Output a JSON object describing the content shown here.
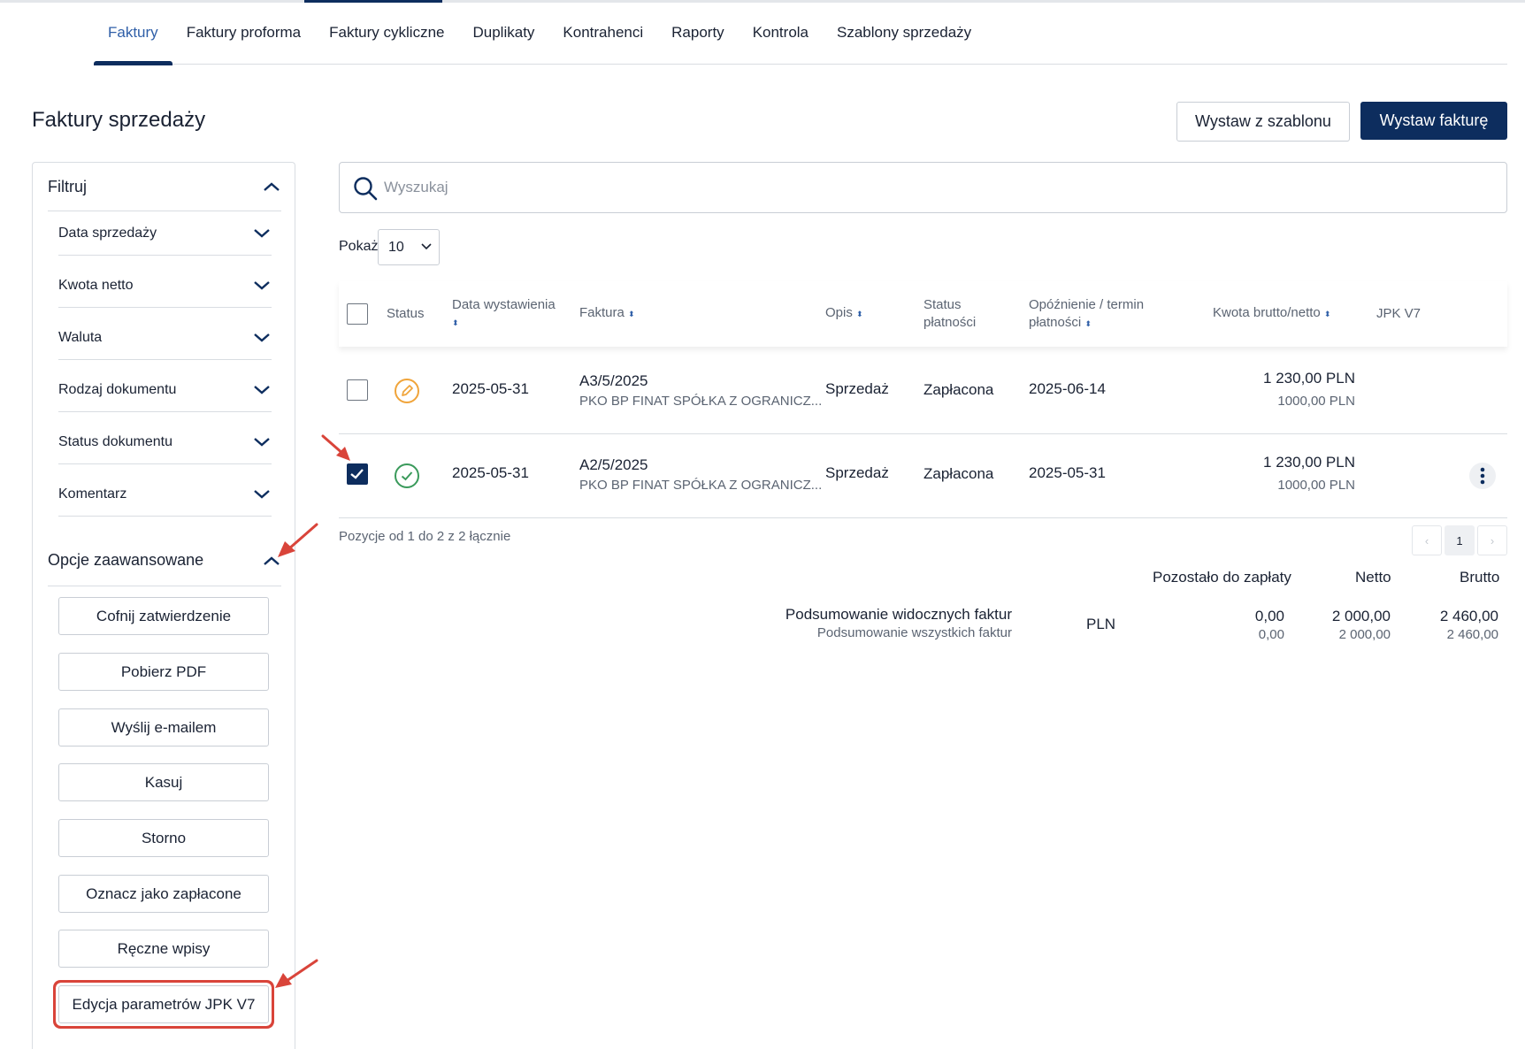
{
  "tabs": [
    {
      "label": "Faktury",
      "active": true
    },
    {
      "label": "Faktury proforma"
    },
    {
      "label": "Faktury cykliczne"
    },
    {
      "label": "Duplikaty"
    },
    {
      "label": "Kontrahenci"
    },
    {
      "label": "Raporty"
    },
    {
      "label": "Kontrola"
    },
    {
      "label": "Szablony sprzedaży"
    }
  ],
  "page_title": "Faktury sprzedaży",
  "actions": {
    "from_template": "Wystaw z szablonu",
    "issue_invoice": "Wystaw fakturę"
  },
  "sidebar": {
    "filter_title": "Filtruj",
    "filters": [
      "Data sprzedaży",
      "Kwota netto",
      "Waluta",
      "Rodzaj dokumentu",
      "Status dokumentu",
      "Komentarz"
    ],
    "advanced_title": "Opcje zaawansowane",
    "advanced_buttons": [
      "Cofnij zatwierdzenie",
      "Pobierz PDF",
      "Wyślij e-mailem",
      "Kasuj",
      "Storno",
      "Oznacz jako zapłacone",
      "Ręczne wpisy",
      "Edycja parametrów JPK V7"
    ]
  },
  "search": {
    "placeholder": "Wyszukaj"
  },
  "page_size": {
    "label": "Pokaż",
    "value": "10"
  },
  "table": {
    "headers": {
      "status": "Status",
      "issue_date": "Data wystawienia",
      "invoice": "Faktura",
      "description": "Opis",
      "payment_status": [
        "Status",
        "płatności"
      ],
      "delay": [
        "Opóźnienie / termin",
        "płatności"
      ],
      "amount": "Kwota brutto/netto",
      "jpk": "JPK V7"
    },
    "rows": [
      {
        "checked": false,
        "status_icon": "pencil-circle-icon",
        "issue_date": "2025-05-31",
        "number": "A3/5/2025",
        "client": "PKO BP FINAT SPÓŁKA Z OGRANICZ...",
        "description": "Sprzedaż",
        "payment_status": "Zapłacona",
        "due": "2025-06-14",
        "gross": "1 230,00 PLN",
        "net": "1000,00 PLN"
      },
      {
        "checked": true,
        "status_icon": "check-circle-icon",
        "issue_date": "2025-05-31",
        "number": "A2/5/2025",
        "client": "PKO BP FINAT SPÓŁKA Z OGRANICZ...",
        "description": "Sprzedaż",
        "payment_status": "Zapłacona",
        "due": "2025-05-31",
        "gross": "1 230,00 PLN",
        "net": "1000,00 PLN"
      }
    ]
  },
  "pagination": {
    "info": "Pozycje od 1 do 2 z 2 łącznie",
    "prev": "‹",
    "current": "1",
    "next": "›"
  },
  "summary": {
    "headers": {
      "remaining": "Pozostało do zapłaty",
      "net": "Netto",
      "gross": "Brutto"
    },
    "visible_label": "Podsumowanie widocznych faktur",
    "all_label": "Podsumowanie wszystkich faktur",
    "currency": "PLN",
    "visible": {
      "remaining": "0,00",
      "net": "2 000,00",
      "gross": "2 460,00"
    },
    "all": {
      "remaining": "0,00",
      "net": "2 000,00",
      "gross": "2 460,00"
    }
  },
  "colors": {
    "primary": "#0d2d5e",
    "link": "#2f5fa8",
    "annotation": "#d9443a",
    "pending": "#f0a43a",
    "paid": "#3a9a5b"
  }
}
